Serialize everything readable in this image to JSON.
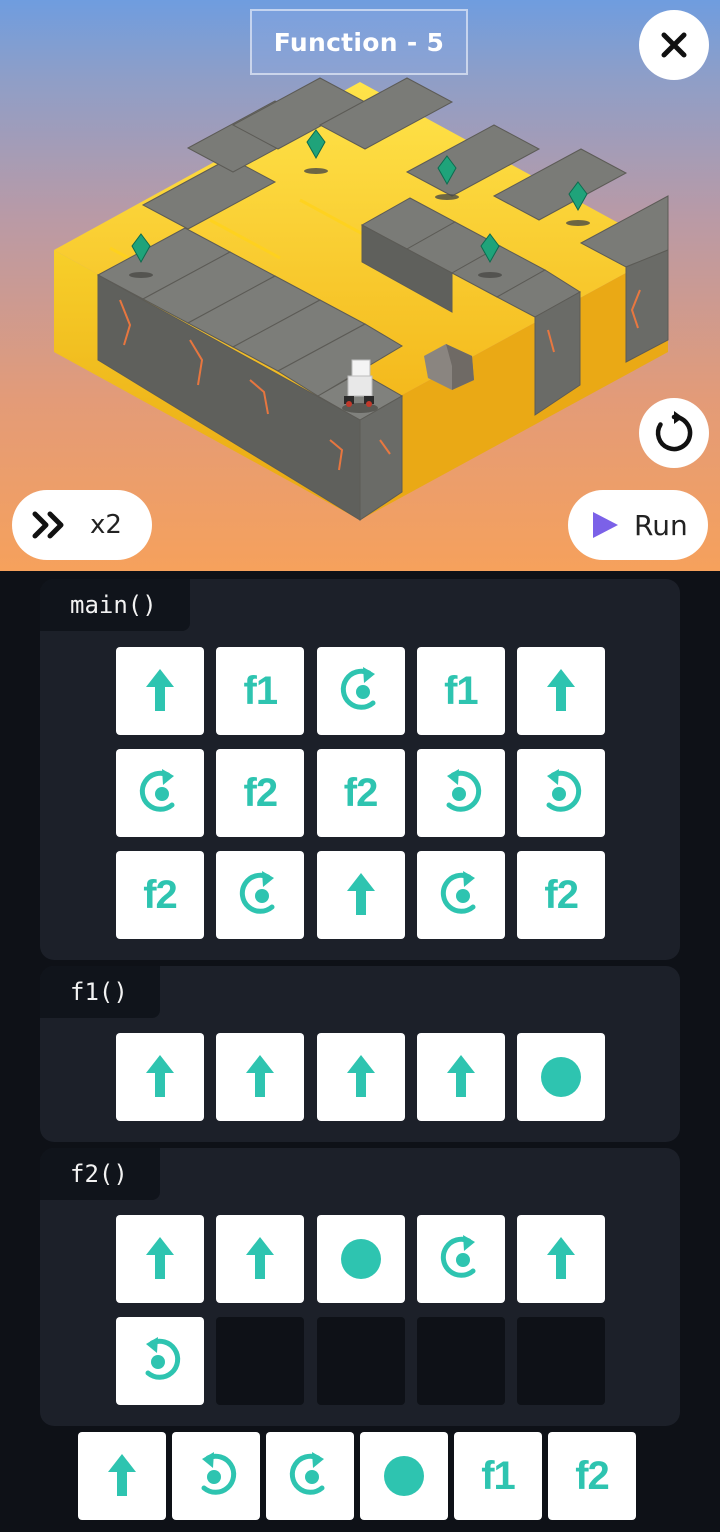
{
  "header": {
    "title": "Function - 5"
  },
  "controls": {
    "speed_label": "x2",
    "run_label": "Run",
    "close_icon": "close-icon",
    "reset_icon": "restart-icon",
    "speed_icon": "fast-forward-icon",
    "run_icon": "play-icon"
  },
  "colors": {
    "accent": "#2ec4b0",
    "run_play": "#7b61e8",
    "panel_bg": "#1c2029",
    "page_bg": "#0e1117"
  },
  "program": {
    "main": {
      "label": "main()",
      "slots": [
        "forward",
        "f1",
        "turn-right",
        "f1",
        "forward",
        "turn-right",
        "f2",
        "f2",
        "turn-left",
        "turn-left",
        "f2",
        "turn-right",
        "forward",
        "turn-right",
        "f2"
      ]
    },
    "f1": {
      "label": "f1()",
      "slots": [
        "forward",
        "forward",
        "forward",
        "forward",
        "light"
      ]
    },
    "f2": {
      "label": "f2()",
      "slots": [
        "forward",
        "forward",
        "light",
        "turn-right",
        "forward",
        "turn-left",
        "",
        "",
        "",
        ""
      ]
    }
  },
  "palette": [
    "forward",
    "turn-left",
    "turn-right",
    "light",
    "f1",
    "f2"
  ],
  "labels": {
    "f1": "f1",
    "f2": "f2"
  }
}
